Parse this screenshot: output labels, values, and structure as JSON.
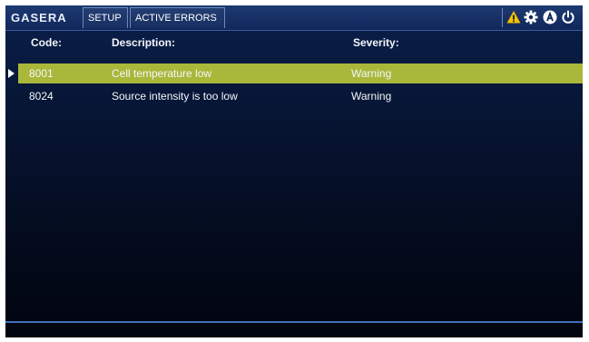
{
  "app": {
    "logo": "GASERA"
  },
  "tabs": [
    {
      "label": "SETUP"
    },
    {
      "label": "ACTIVE ERRORS"
    }
  ],
  "toolbar_icons": [
    "warning-icon",
    "gear-icon",
    "a-badge-icon",
    "power-icon"
  ],
  "colors": {
    "background": "#071636",
    "topbar": "#1e3a72",
    "selected_row": "#a9b83a",
    "warning": "#f2c200",
    "accent_line": "#3d6fbf"
  },
  "table": {
    "headers": {
      "code": "Code:",
      "description": "Description:",
      "severity": "Severity:"
    },
    "rows": [
      {
        "code": "8001",
        "description": "Cell temperature low",
        "severity": "Warning",
        "selected": true
      },
      {
        "code": "8024",
        "description": "Source intensity is too low",
        "severity": "Warning",
        "selected": false
      }
    ]
  }
}
